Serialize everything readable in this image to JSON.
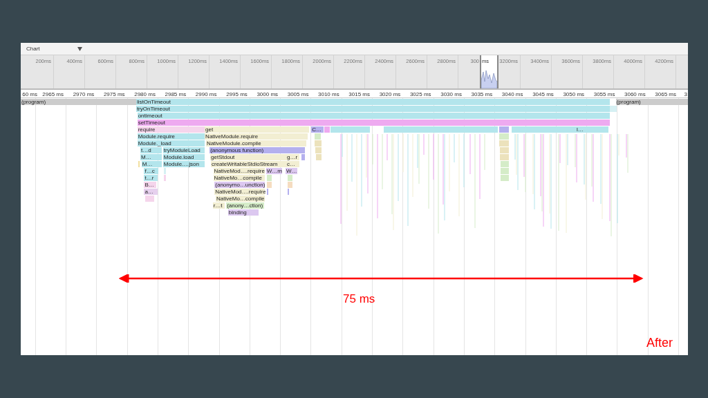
{
  "toolbar": {
    "view_select": "Chart"
  },
  "overview": {
    "ticks": [
      "200ms",
      "400ms",
      "600ms",
      "800ms",
      "1000ms",
      "1200ms",
      "1400ms",
      "1600ms",
      "1800ms",
      "2000ms",
      "2200ms",
      "2400ms",
      "2600ms",
      "2800ms",
      "300",
      "3200ms",
      "3400ms",
      "3600ms",
      "3800ms",
      "4000ms",
      "4200ms"
    ],
    "window_label": "ms"
  },
  "ruler": {
    "ticks": [
      "60 ms",
      "2965 ms",
      "2970 ms",
      "2975 ms",
      "2980 ms",
      "2985 ms",
      "2990 ms",
      "2995 ms",
      "3000 ms",
      "3005 ms",
      "3010 ms",
      "3015 ms",
      "3020 ms",
      "3025 ms",
      "3030 ms",
      "3035 ms",
      "3040 ms",
      "3045 ms",
      "3050 ms",
      "3055 ms",
      "3060 ms",
      "3065 ms",
      "3"
    ]
  },
  "rows": [
    [
      {
        "label": "(program)",
        "color": "#cccccc"
      },
      {
        "label": "listOnTimeout",
        "color": "#b3e5ec"
      },
      {
        "label": "(program)",
        "color": "#cccccc"
      }
    ],
    [
      {
        "label": "tryOnTimeout",
        "color": "#b3e5ec"
      },
      {
        "color": "#d6f0f3"
      }
    ],
    [
      {
        "label": "ontimeout",
        "color": "#b3e5ec"
      }
    ],
    [
      {
        "label": "setTimeout",
        "color": "#eeaaf0"
      }
    ],
    [
      {
        "label": "require",
        "color": "#f5d5ec"
      },
      {
        "label": "get",
        "color": "#f2eed2"
      },
      {
        "label": "C…",
        "color": "#b4b0ee"
      },
      {
        "color": "#eeaaf0"
      },
      {
        "color": "#b3e5ec"
      },
      {
        "color": "#b3e5ec"
      },
      {
        "color": "#b4b0ee"
      },
      {
        "color": "#b3e5ec"
      },
      {
        "label": "l…",
        "color": "#b3e5ec"
      },
      {
        "color": "#b3e5ec"
      }
    ],
    [
      {
        "label": "Module.require",
        "color": "#b3e5ec"
      },
      {
        "label": "NativeModule.require",
        "color": "#f2eed2"
      },
      {
        "color": "#d5ecc8"
      },
      {
        "color": "#d5ecc8"
      }
    ],
    [
      {
        "label": "Module._load",
        "color": "#b3e5ec"
      },
      {
        "label": "NativeModule.compile",
        "color": "#f2eed2"
      },
      {
        "color": "#ece2bc"
      },
      {
        "color": "#ece2bc"
      }
    ],
    [
      {
        "label": "t…d",
        "color": "#b3e5ec"
      },
      {
        "label": "tryModuleLoad",
        "color": "#b3e5ec"
      },
      {
        "label": "(anonymous function)",
        "color": "#b4b0ee"
      },
      {
        "color": "#ece2bc"
      },
      {
        "color": "#ece2bc"
      }
    ],
    [
      {
        "label": "M…",
        "color": "#b3e5ec"
      },
      {
        "label": "Module.load",
        "color": "#b3e5ec"
      },
      {
        "label": "getStdout",
        "color": "#f2eed2"
      },
      {
        "label": "g…r",
        "color": "#f2eed2"
      },
      {
        "color": "#b4b0ee"
      },
      {
        "color": "#ece2bc"
      },
      {
        "color": "#ece2bc"
      }
    ],
    [
      {
        "color": "#f2e0a0"
      },
      {
        "label": "M…",
        "color": "#b3e5ec"
      },
      {
        "label": "Module.…json",
        "color": "#b3e5ec"
      },
      {
        "label": "createWritableStdioStream",
        "color": "#f2eed2"
      },
      {
        "label": "c…",
        "color": "#f2eed2"
      },
      {
        "color": "#d5ecc8"
      }
    ],
    [
      {
        "label": "f…c",
        "color": "#b3e5ec"
      },
      {
        "color": "#d6f0f3"
      },
      {
        "label": "NativeMod….require",
        "color": "#f2eed2"
      },
      {
        "label": "W…m",
        "color": "#dcc8f0"
      },
      {
        "label": "W…",
        "color": "#dcc8f0"
      },
      {
        "color": "#d5ecc8"
      }
    ],
    [
      {
        "label": "t…r",
        "color": "#b3e5ec"
      },
      {
        "color": "#f5d5ec"
      },
      {
        "label": "NativeMo…compile",
        "color": "#f2eed2"
      },
      {
        "color": "#d5ecc8"
      },
      {
        "color": "#d5ecc8"
      },
      {
        "color": "#d5ecc8"
      }
    ],
    [
      {
        "label": "B…",
        "color": "#f5d5ec"
      },
      {
        "label": "(anonymo…unction)",
        "color": "#dcc8f0"
      },
      {
        "color": "#f5dcc0"
      },
      {
        "color": "#f5dcc0"
      }
    ],
    [
      {
        "label": "a…",
        "color": "#e6d0ee"
      },
      {
        "label": "NativeMod….require",
        "color": "#f2eed2"
      },
      {
        "color": "#b4b0ee"
      },
      {
        "color": "#b4b0ee"
      }
    ],
    [
      {
        "color": "#f5d5ec"
      },
      {
        "label": "NativeMo…compile",
        "color": "#f2eed2"
      }
    ],
    [
      {
        "label": "r…t",
        "color": "#f2eed2"
      },
      {
        "label": "(anony…ction)",
        "color": "#d5ecc8"
      }
    ],
    [
      {
        "label": "binding",
        "color": "#dcc8f0"
      }
    ]
  ],
  "annotation": {
    "span_label": "75 ms",
    "caption": "After"
  }
}
